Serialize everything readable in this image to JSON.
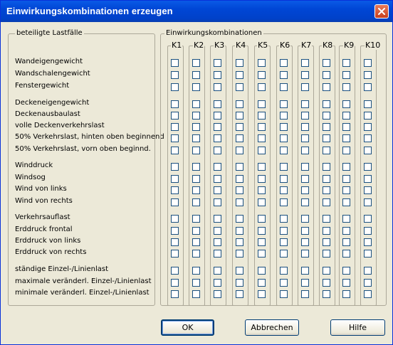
{
  "window": {
    "title": "Einwirkungskombinationen erzeugen"
  },
  "left_group": {
    "title": "beteiligte Lastfälle",
    "loads": [
      "Wandeigengewicht",
      "Wandschalengewicht",
      "Fenstergewicht",
      "Deckeneigengewicht",
      "Deckenausbaulast",
      "volle Deckenverkehrslast",
      "50% Verkehrslast, hinten oben beginnend",
      "50% Verkehrslast, vorn oben beginnd.",
      "Winddruck",
      "Windsog",
      "Wind von links",
      "Wind von rechts",
      "Verkehrsauflast",
      "Erddruck frontal",
      "Erddruck von links",
      "Erddruck von rechts",
      "ständige Einzel-/Linienlast",
      "maximale veränderl. Einzel-/Linienlast",
      "minimale veränderl. Einzel-/Linienlast"
    ]
  },
  "right_group": {
    "title": "Einwirkungskombinationen",
    "columns": [
      "K1",
      "K2",
      "K3",
      "K4",
      "K5",
      "K6",
      "K7",
      "K8",
      "K9",
      "K10"
    ]
  },
  "buttons": {
    "ok": "OK",
    "cancel": "Abbrechen",
    "help": "Hilfe"
  }
}
